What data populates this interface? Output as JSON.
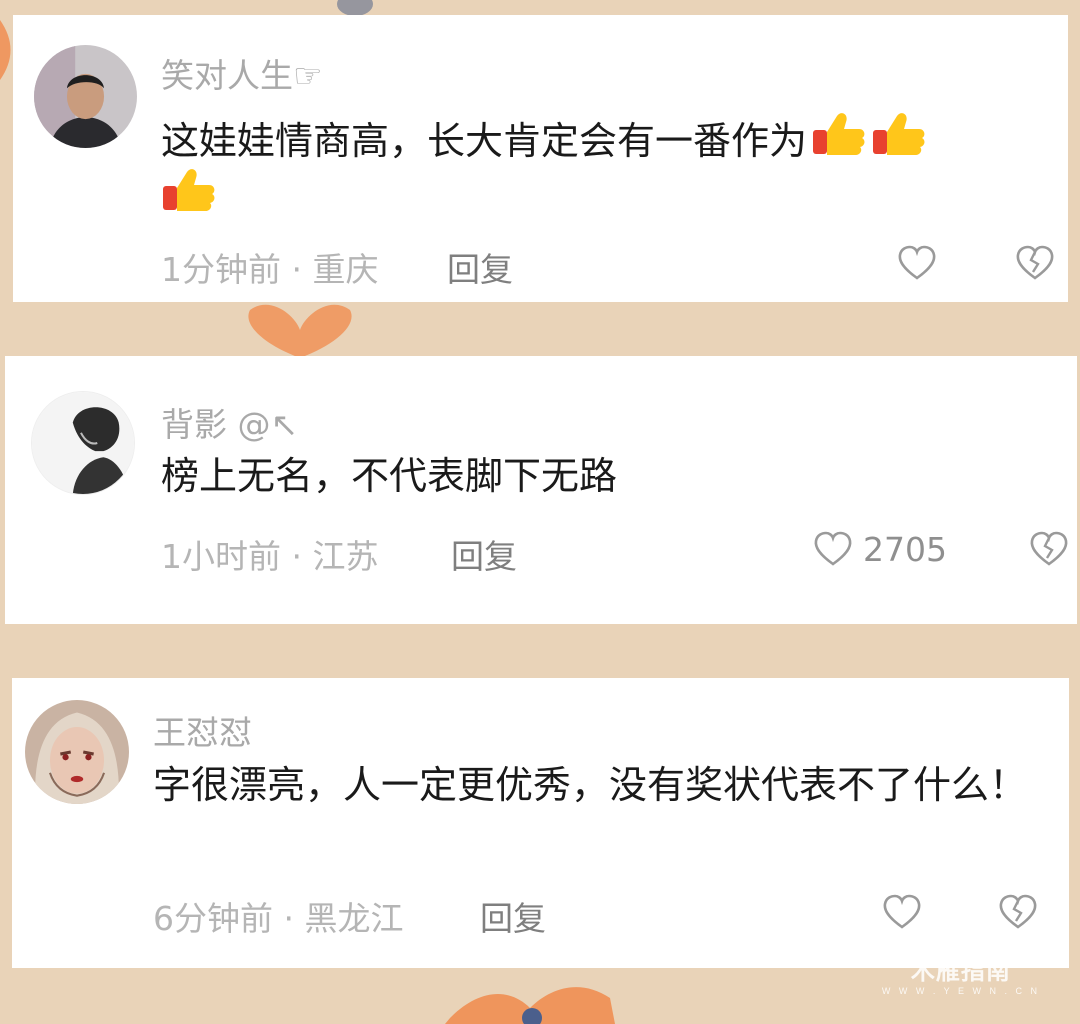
{
  "comments": [
    {
      "username": "笑对人生☞",
      "text": "这娃娃情商高，长大肯定会有一番作为",
      "emoji_count": 3,
      "time": "1分钟前",
      "location": "重庆",
      "reply_label": "回复",
      "like_count": ""
    },
    {
      "username": "背影 @↖",
      "text": "榜上无名，不代表脚下无路",
      "emoji_count": 0,
      "time": "1小时前",
      "location": "江苏",
      "reply_label": "回复",
      "like_count": "2705"
    },
    {
      "username": "王怼怼",
      "text": "字很漂亮，人一定更优秀，没有奖状代表不了什么！",
      "emoji_count": 0,
      "time": "6分钟前",
      "location": "黑龙江",
      "reply_label": "回复",
      "like_count": ""
    }
  ],
  "icons": {
    "like": "heart-outline-icon",
    "dislike": "broken-heart-icon",
    "emoji": "thumbs-up-emoji"
  },
  "watermark": {
    "brand": "木雁指南",
    "domain": "W W W . Y E W N . C N"
  },
  "colors": {
    "background": "#e9d3b8",
    "card": "#ffffff",
    "username": "#a9a9a9",
    "text": "#1a1a1a",
    "meta": "#b5b5b5",
    "decor": "#f08a4b"
  }
}
